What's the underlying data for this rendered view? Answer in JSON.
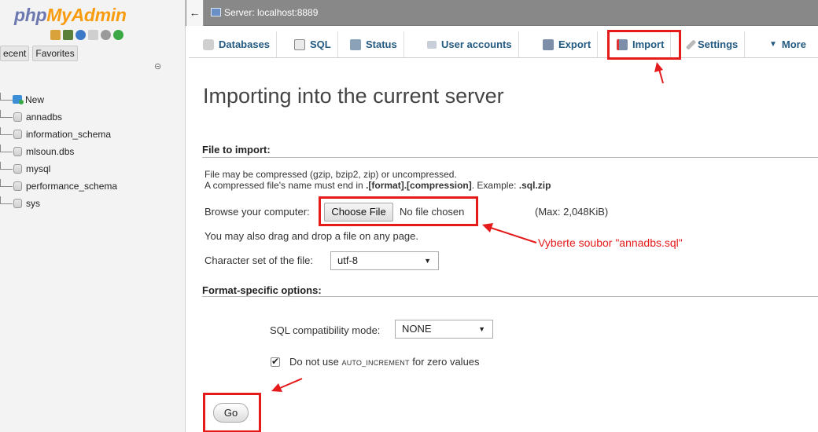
{
  "sidebar": {
    "logo_php": "php",
    "logo_myadmin": "MyAdmin",
    "tabs": [
      "ecent",
      "Favorites"
    ],
    "tree": [
      {
        "label": "New"
      },
      {
        "label": "annadbs"
      },
      {
        "label": "information_schema"
      },
      {
        "label": "mlsoun.dbs"
      },
      {
        "label": "mysql"
      },
      {
        "label": "performance_schema"
      },
      {
        "label": "sys"
      }
    ]
  },
  "server_bar": {
    "collapse": "←",
    "label": "Server: localhost:8889"
  },
  "tabs": {
    "databases": "Databases",
    "sql": "SQL",
    "status": "Status",
    "user_accounts": "User accounts",
    "export": "Export",
    "import": "Import",
    "settings": "Settings",
    "more": "More"
  },
  "main": {
    "title": "Importing into the current server",
    "file_to_import": "File to import:",
    "compress_note": "File may be compressed (gzip, bzip2, zip) or uncompressed.",
    "compress_name_prefix": "A compressed file's name must end in ",
    "compress_name_format": ".[format].[compression]",
    "compress_name_mid": ". Example: ",
    "compress_name_example": ".sql.zip",
    "browse_label": "Browse your computer:",
    "choose_file": "Choose File",
    "no_file": "No file chosen",
    "max_size": "(Max: 2,048KiB)",
    "drag_drop": "You may also drag and drop a file on any page.",
    "charset_label": "Character set of the file:",
    "charset_value": "utf-8",
    "format_options": "Format-specific options:",
    "sql_compat_label": "SQL compatibility mode:",
    "sql_compat_value": "NONE",
    "auto_inc_prefix": "Do not use ",
    "auto_inc_code": "AUTO_INCREMENT",
    "auto_inc_suffix": " for zero values",
    "go": "Go"
  },
  "annotation": "Vyberte soubor \"annadbs.sql\"",
  "colors": {
    "highlight": "#e51a1a",
    "tab_text": "#235a81",
    "logo_php": "#6c78af",
    "logo_myadmin": "#f89c0e"
  }
}
